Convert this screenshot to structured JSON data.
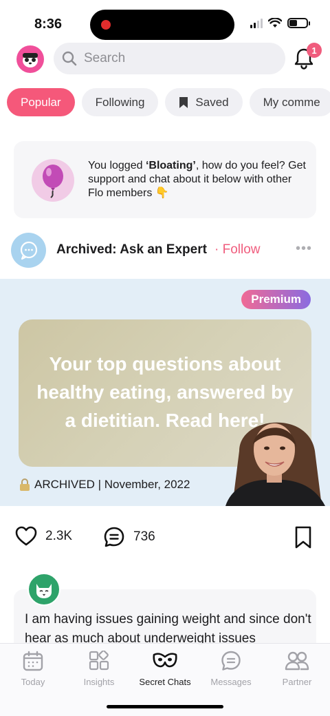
{
  "status_bar": {
    "time": "8:36"
  },
  "header": {
    "search_placeholder": "Search",
    "notification_count": "1"
  },
  "tabs": [
    {
      "label": "Popular",
      "active": true
    },
    {
      "label": "Following"
    },
    {
      "label": "Saved"
    },
    {
      "label": "My comme"
    }
  ],
  "prompt_card": {
    "text_before": "You logged ",
    "symptom": "‘Bloating’",
    "text_after": ", how do you feel? Get support and chat about it below with other Flo members 👇"
  },
  "post": {
    "group_name": "Archived: Ask an Expert",
    "follow_label": "· Follow",
    "premium_label": "Premium",
    "hero_title": "Your top questions about healthy eating, answered by a dietitian. Read here!",
    "archived_label": "ARCHIVED | November, 2022",
    "likes": "2.3K",
    "comments": "736"
  },
  "next_post": {
    "text": "I am having issues gaining weight and since don't hear as much about underweight issues"
  },
  "bottom_nav": [
    {
      "label": "Today"
    },
    {
      "label": "Insights"
    },
    {
      "label": "Secret Chats",
      "active": true
    },
    {
      "label": "Messages"
    },
    {
      "label": "Partner"
    }
  ],
  "colors": {
    "accent": "#f5587a",
    "follow": "#f05c7d",
    "hero_bg": "#e3eef7"
  }
}
